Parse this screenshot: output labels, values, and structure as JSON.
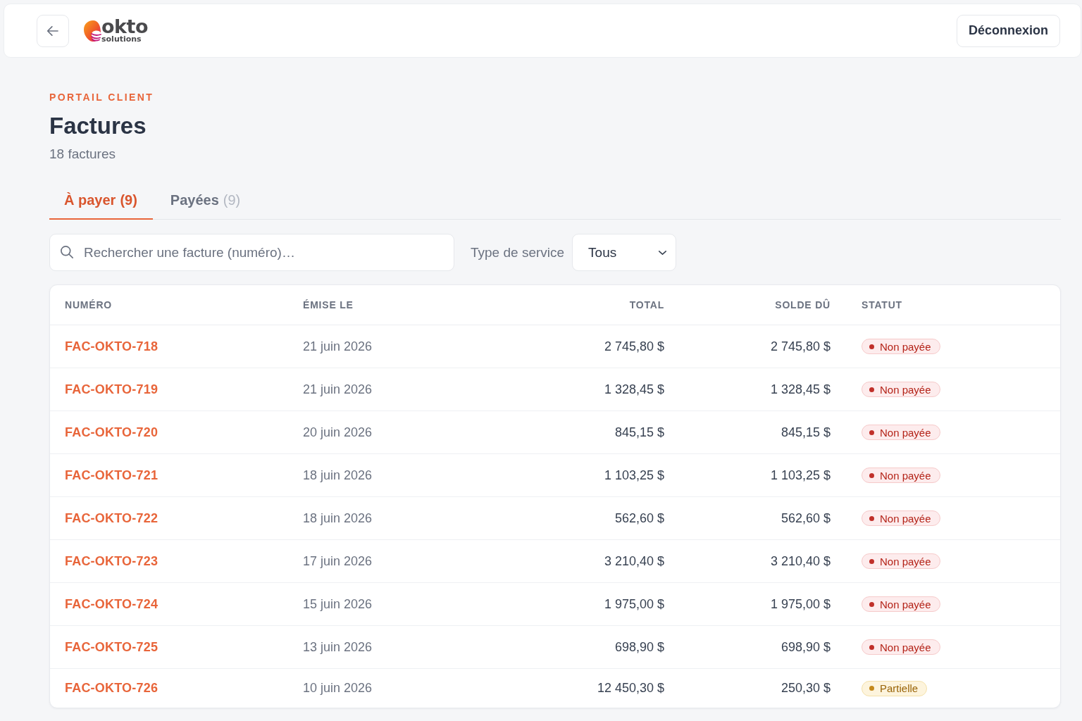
{
  "header": {
    "logo": {
      "wordmark": "okto",
      "tagline": "solutions"
    },
    "logout_button": "Déconnexion"
  },
  "page": {
    "eyebrow": "PORTAIL CLIENT",
    "title": "Factures",
    "subtitle": "18 factures"
  },
  "tabs": [
    {
      "label": "À payer",
      "count": "(9)",
      "selected": true
    },
    {
      "label": "Payées",
      "count": "(9)",
      "selected": false
    }
  ],
  "filters": {
    "search": {
      "placeholder": "Rechercher une facture (numéro)…"
    },
    "service_type": {
      "label": "Type de service",
      "value": "Tous"
    }
  },
  "table": {
    "columns": [
      "NUMÉRO",
      "ÉMISE LE",
      "TOTAL",
      "SOLDE DÛ",
      "STATUT"
    ],
    "rows": [
      {
        "number": "FAC-OKTO-718",
        "issued": "21 juin 2026",
        "total": "2 745,80 $",
        "balance": "2 745,80 $",
        "status": {
          "label": "Non payée",
          "kind": "unpaid"
        }
      },
      {
        "number": "FAC-OKTO-719",
        "issued": "21 juin 2026",
        "total": "1 328,45 $",
        "balance": "1 328,45 $",
        "status": {
          "label": "Non payée",
          "kind": "unpaid"
        }
      },
      {
        "number": "FAC-OKTO-720",
        "issued": "20 juin 2026",
        "total": "845,15 $",
        "balance": "845,15 $",
        "status": {
          "label": "Non payée",
          "kind": "unpaid"
        }
      },
      {
        "number": "FAC-OKTO-721",
        "issued": "18 juin 2026",
        "total": "1 103,25 $",
        "balance": "1 103,25 $",
        "status": {
          "label": "Non payée",
          "kind": "unpaid"
        }
      },
      {
        "number": "FAC-OKTO-722",
        "issued": "18 juin 2026",
        "total": "562,60 $",
        "balance": "562,60 $",
        "status": {
          "label": "Non payée",
          "kind": "unpaid"
        }
      },
      {
        "number": "FAC-OKTO-723",
        "issued": "17 juin 2026",
        "total": "3 210,40 $",
        "balance": "3 210,40 $",
        "status": {
          "label": "Non payée",
          "kind": "unpaid"
        }
      },
      {
        "number": "FAC-OKTO-724",
        "issued": "15 juin 2026",
        "total": "1 975,00 $",
        "balance": "1 975,00 $",
        "status": {
          "label": "Non payée",
          "kind": "unpaid"
        }
      },
      {
        "number": "FAC-OKTO-725",
        "issued": "13 juin 2026",
        "total": "698,90 $",
        "balance": "698,90 $",
        "status": {
          "label": "Non payée",
          "kind": "unpaid"
        }
      },
      {
        "number": "FAC-OKTO-726",
        "issued": "10 juin 2026",
        "total": "12 450,30 $",
        "balance": "250,30 $",
        "status": {
          "label": "Partielle",
          "kind": "partial"
        }
      }
    ]
  }
}
